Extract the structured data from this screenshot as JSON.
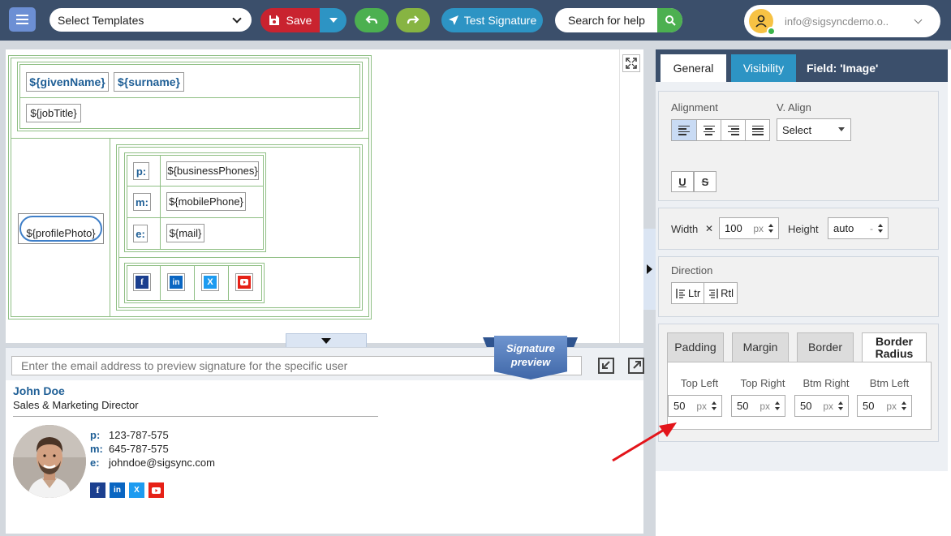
{
  "toolbar": {
    "template_select": "Select Templates",
    "save_label": "Save",
    "test_label": "Test Signature",
    "search_label": "Search for help",
    "user_email": "info@sigsyncdemo.o.."
  },
  "editor": {
    "given_name": "${givenName}",
    "surname": "${surname}",
    "job_title": "${jobTitle}",
    "profile_photo": "${profilePhoto}",
    "contacts": [
      {
        "label": "p:",
        "value": "${businessPhones}"
      },
      {
        "label": "m:",
        "value": "${mobilePhone}"
      },
      {
        "label": "e:",
        "value": "${mail}"
      }
    ],
    "socials": [
      "f",
      "in",
      "X",
      "yt"
    ]
  },
  "preview": {
    "placeholder": "Enter the email address to preview signature for the specific user",
    "ribbon_line1": "Signature",
    "ribbon_line2": "preview",
    "name": "John Doe",
    "title": "Sales & Marketing Director",
    "contacts": [
      {
        "label": "p:",
        "value": "123-787-575"
      },
      {
        "label": "m:",
        "value": "645-787-575"
      },
      {
        "label": "e:",
        "value": "johndoe@sigsync.com"
      }
    ]
  },
  "panel": {
    "tabs": {
      "general": "General",
      "visibility": "Visibility",
      "field": "Field: 'Image'"
    },
    "alignment_label": "Alignment",
    "valign_label": "V. Align",
    "valign_value": "Select",
    "underline": "U",
    "strike": "S",
    "width_label": "Width",
    "width_x": "✕",
    "width_value": "100",
    "width_unit": "px",
    "height_label": "Height",
    "height_value": "auto",
    "height_unit": "-",
    "direction_label": "Direction",
    "ltr": "Ltr",
    "rtl": "Rtl",
    "subtabs": {
      "padding": "Padding",
      "margin": "Margin",
      "border": "Border",
      "radius_line1": "Border",
      "radius_line2": "Radius"
    },
    "radius_fields": [
      {
        "label": "Top Left",
        "value": "50",
        "unit": "px"
      },
      {
        "label": "Top Right",
        "value": "50",
        "unit": "px"
      },
      {
        "label": "Btm Right",
        "value": "50",
        "unit": "px"
      },
      {
        "label": "Btm Left",
        "value": "50",
        "unit": "px"
      }
    ]
  },
  "colors": {
    "topbar": "#3b4f6b",
    "accent_blue": "#2d94c4",
    "save_red": "#c9232f",
    "green": "#4cb050",
    "facebook": "#1b3f8f",
    "linkedin": "#0a66c2",
    "twitter": "#1d9bf0",
    "youtube": "#e62117",
    "arrow_red": "#e3141a"
  }
}
